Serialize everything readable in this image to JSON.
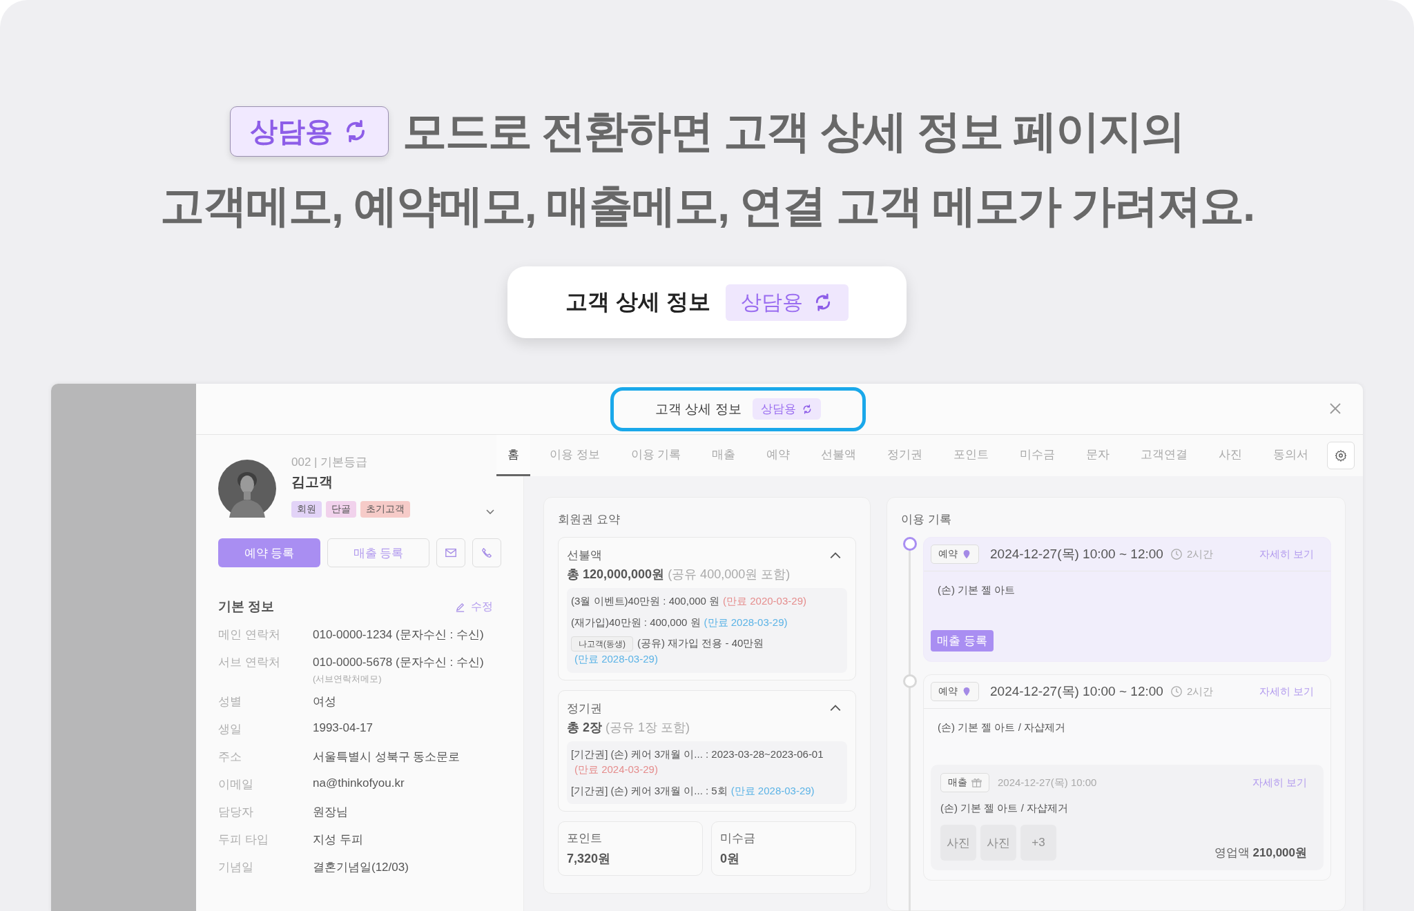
{
  "headline": {
    "badge": "상담용",
    "line1": "모드로 전환하면 고객 상세 정보 페이지의",
    "line2": "고객메모, 예약메모, 매출메모, 연결 고객 메모가 가려져요."
  },
  "callout": {
    "title": "고객 상세 정보",
    "badge": "상담용"
  },
  "modal": {
    "title": "고객 상세 정보",
    "badge": "상담용",
    "highlighted": true
  },
  "customer": {
    "code_grade": "002 | 기본등급",
    "name": "김고객",
    "tags": [
      {
        "label": "회원",
        "color": "#e2d3f7"
      },
      {
        "label": "단골",
        "color": "#f1d2ec"
      },
      {
        "label": "초기고객",
        "color": "#f6cbc8"
      }
    ]
  },
  "actions": {
    "primary": "예약 등록",
    "secondary": "매출 등록"
  },
  "basic_info": {
    "title": "기본 정보",
    "edit": "수정",
    "rows": [
      {
        "label": "메인 연락처",
        "value": "010-0000-1234 (문자수신 : 수신)"
      },
      {
        "label": "서브 연락처",
        "value": "010-0000-5678 (문자수신 : 수신)",
        "note": "(서브연락처메모)"
      },
      {
        "label": "성별",
        "value": "여성"
      },
      {
        "label": "생일",
        "value": "1993-04-17"
      },
      {
        "label": "주소",
        "value": "서울특별시 성북구 동소문로"
      },
      {
        "label": "이메일",
        "value": "na@thinkofyou.kr"
      },
      {
        "label": "담당자",
        "value": "원장님"
      },
      {
        "label": "두피 타입",
        "value": "지성 두피"
      },
      {
        "label": "기념일",
        "value": "결혼기념일(12/03)"
      }
    ]
  },
  "tabs": [
    {
      "label": "홈",
      "selected": true
    },
    {
      "label": "이용 정보",
      "selected": false
    },
    {
      "label": "이용 기록",
      "selected": false
    },
    {
      "label": "매출",
      "selected": false
    },
    {
      "label": "예약",
      "selected": false
    },
    {
      "label": "선불액",
      "selected": false
    },
    {
      "label": "정기권",
      "selected": false
    },
    {
      "label": "포인트",
      "selected": false
    },
    {
      "label": "미수금",
      "selected": false
    },
    {
      "label": "문자",
      "selected": false
    },
    {
      "label": "고객연결",
      "selected": false
    },
    {
      "label": "사진",
      "selected": false
    },
    {
      "label": "동의서",
      "selected": false
    }
  ],
  "membership": {
    "title": "회원권 요약",
    "sections": [
      {
        "title": "선불액",
        "expanded": true,
        "total": "총 120,000,000원",
        "shared": "(공유 400,000원 포함)",
        "items": [
          {
            "text": "(3월 이벤트)40만원 : 400,000 원",
            "expiry": "(만료 2020-03-29)",
            "expired": true
          },
          {
            "text": "(재가입)40만원 : 400,000 원",
            "expiry": "(만료 2028-03-29)",
            "expired": false
          },
          {
            "owner": "나고객(동생)",
            "text": "(공유) 재가입 전용 - 40만원",
            "expiry": "(만료 2028-03-29)",
            "expired": false
          }
        ]
      },
      {
        "title": "정기권",
        "expanded": true,
        "total": "총 2장",
        "shared": "(공유 1장 포함)",
        "items": [
          {
            "text": "[기간권] (손) 케어 3개월 이... : 2023-03-28~2023-06-01",
            "expiry": "(만료 2024-03-29)",
            "expired": true
          },
          {
            "text": "[기간권] (손) 케어 3개월 이... : 5회",
            "expiry": "(만료 2028-03-29)",
            "expired": false
          }
        ]
      }
    ],
    "stats": [
      {
        "label": "포인트",
        "value": "7,320원"
      },
      {
        "label": "미수금",
        "value": "0원"
      }
    ]
  },
  "history": {
    "title": "이용 기록",
    "records": [
      {
        "kind": "reservation",
        "active": true,
        "tag": "예약",
        "datetime": "2024-12-27(목) 10:00 ~ 12:00",
        "duration": "2시간",
        "link": "자세히 보기",
        "service": "(손) 기본 젤 아트",
        "button": "매출 등록"
      },
      {
        "kind": "reservation",
        "active": false,
        "tag": "예약",
        "datetime": "2024-12-27(목) 10:00 ~ 12:00",
        "duration": "2시간",
        "link": "자세히 보기",
        "service": "(손) 기본 젤 아트 / 자샵제거",
        "sale": {
          "tag": "매출",
          "datetime": "2024-12-27(목) 10:00",
          "link": "자세히 보기",
          "service": "(손) 기본 젤 아트 / 자샵제거",
          "photos": [
            "사진",
            "사진",
            "+3"
          ],
          "revenue_label": "영업액",
          "revenue": "210,000원"
        }
      }
    ]
  }
}
